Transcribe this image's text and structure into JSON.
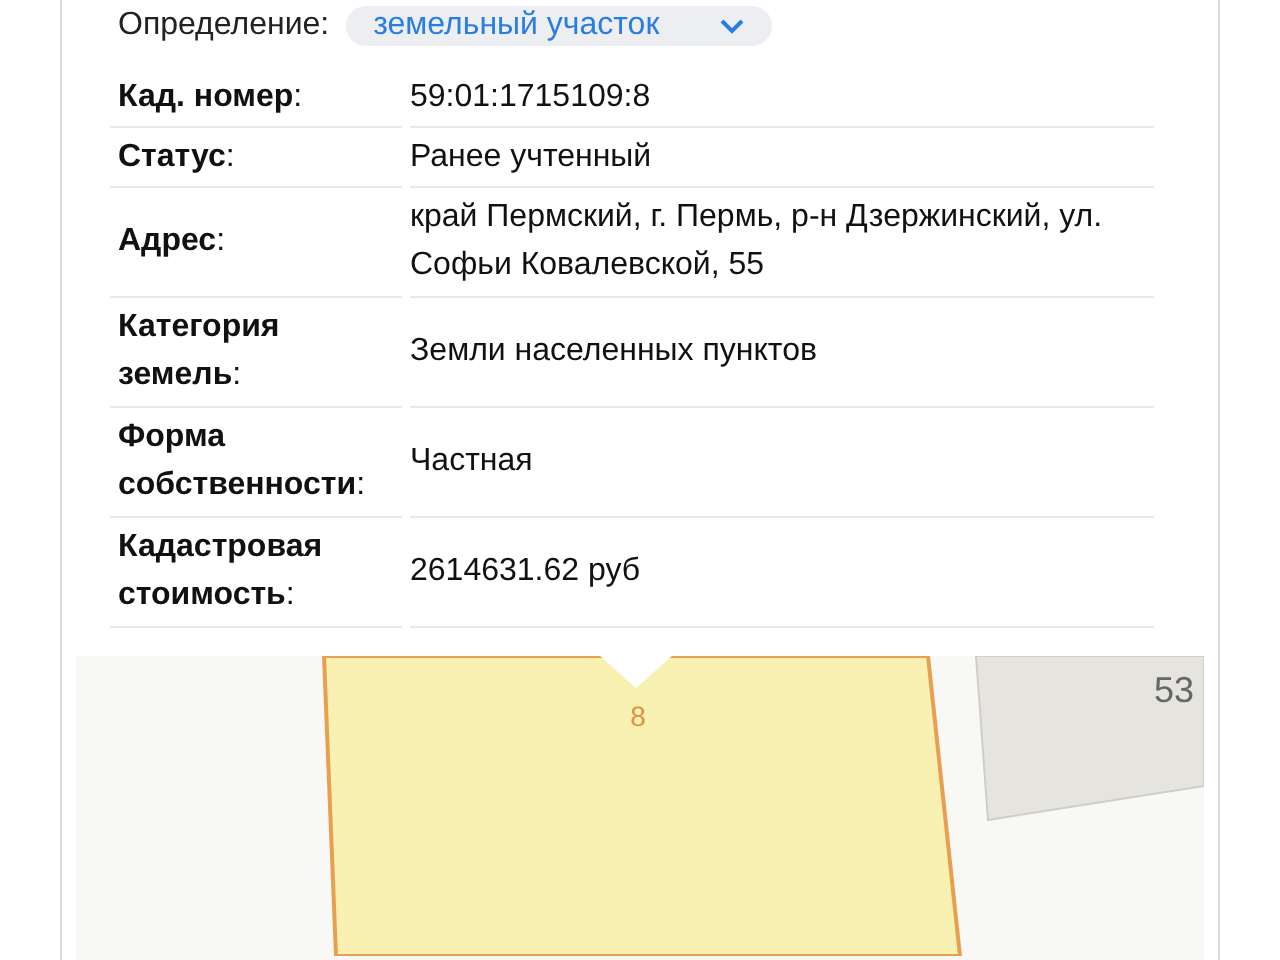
{
  "filter": {
    "label": "Определение:",
    "value": "земельный участок"
  },
  "rows": [
    {
      "label": "**Кад. номер**:",
      "value": "59:01:1715109:8"
    },
    {
      "label": "**Статус**:",
      "value": "Ранее учтенный"
    },
    {
      "label": "**Адрес**:",
      "value": "край Пермский, г. Пермь, р-н Дзержинский, ул. Софьи Ковалевской, 55"
    },
    {
      "label": "**Категория земель**:",
      "value": "Земли населенных пунктов"
    },
    {
      "label": "**Форма собственности**:",
      "value": "Частная"
    },
    {
      "label": "**Кадастровая стоимость**:",
      "value": "2614631.62 руб"
    }
  ],
  "map": {
    "parcel_label": "8",
    "house_number": "53"
  }
}
